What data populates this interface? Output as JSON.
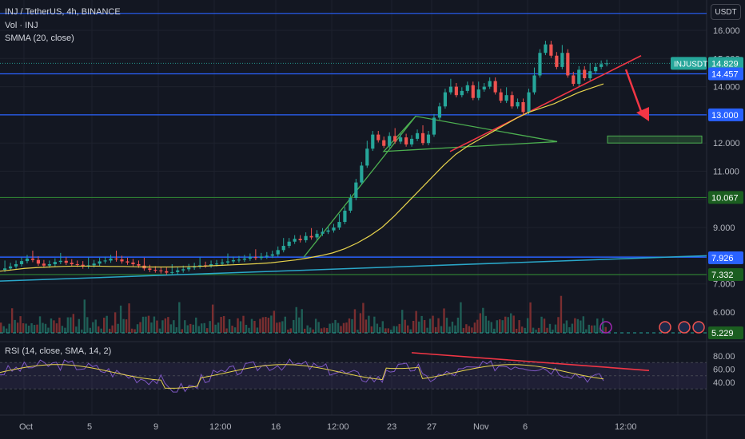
{
  "header": {
    "symbol": "INJ / TetherUS, 4h, BINANCE",
    "volume": "Vol · INJ",
    "smma": "SMMA (20, close)"
  },
  "currency_button": "USDT",
  "price_axis": {
    "ticks": [
      "16.000",
      "15.000",
      "14.000",
      "13.000",
      "12.000",
      "11.000",
      "10.000",
      "9.000",
      "8.000",
      "7.000",
      "6.000"
    ]
  },
  "price_tags": [
    {
      "label": "INJUSDT",
      "value": "14.829",
      "color": "#26a69a"
    },
    {
      "value": "14.457",
      "color": "#2962ff"
    },
    {
      "value": "13.000",
      "color": "#2962ff"
    },
    {
      "value": "10.067",
      "color": "#1b5e20"
    },
    {
      "value": "7.926",
      "color": "#2962ff"
    },
    {
      "value": "7.332",
      "color": "#1b5e20"
    },
    {
      "value": "5.229",
      "color": "#1b5e20"
    }
  ],
  "rsi": {
    "title": "RSI (14, close, SMA, 14, 2)",
    "ticks": [
      "80.00",
      "60.00",
      "40.00"
    ]
  },
  "time_axis": [
    "Oct",
    "5",
    "9",
    "12:00",
    "16",
    "12:00",
    "23",
    "27",
    "Nov",
    "6",
    "12:00"
  ],
  "colors": {
    "up": "#26a69a",
    "down": "#ef5350",
    "blue": "#2962ff",
    "green_line": "#2e7d32",
    "smma": "#e8d44d",
    "rsi": "#7e57c2"
  },
  "chart_data": {
    "type": "candlestick",
    "symbol": "INJ / TetherUS, 4h, BINANCE",
    "close": [
      7.55,
      7.62,
      7.7,
      7.81,
      7.9,
      7.85,
      7.72,
      7.65,
      7.7,
      7.78,
      7.82,
      7.75,
      7.7,
      7.68,
      7.62,
      7.66,
      7.72,
      7.8,
      7.83,
      7.9,
      7.87,
      7.8,
      7.76,
      7.7,
      7.65,
      7.55,
      7.5,
      7.48,
      7.45,
      7.4,
      7.42,
      7.48,
      7.52,
      7.58,
      7.62,
      7.66,
      7.65,
      7.7,
      7.72,
      7.76,
      7.8,
      7.84,
      7.86,
      7.9,
      7.95,
      7.92,
      7.97,
      8.0,
      8.05,
      8.2,
      8.35,
      8.5,
      8.6,
      8.55,
      8.7,
      8.65,
      8.78,
      8.85,
      8.9,
      9.0,
      9.2,
      9.6,
      10.05,
      10.6,
      11.2,
      11.8,
      12.3,
      12.1,
      11.9,
      12.25,
      12.05,
      12.2,
      11.95,
      12.15,
      12.35,
      12.0,
      12.3,
      12.9,
      13.3,
      13.8,
      14.0,
      13.7,
      13.85,
      14.05,
      13.6,
      13.9,
      14.0,
      14.2,
      13.8,
      13.5,
      13.7,
      13.3,
      13.45,
      13.1,
      13.8,
      14.4,
      15.2,
      15.5,
      15.1,
      14.7,
      15.2,
      14.4,
      14.1,
      14.6,
      14.3,
      14.55,
      14.7,
      14.8,
      14.83
    ],
    "smma": [
      7.45,
      7.5,
      7.55,
      7.58,
      7.6,
      7.62,
      7.63,
      7.63,
      7.63,
      7.62,
      7.62,
      7.61,
      7.6,
      7.6,
      7.6,
      7.61,
      7.62,
      7.64,
      7.66,
      7.68,
      7.7,
      7.72,
      7.75,
      7.8,
      7.85,
      7.92,
      8.0,
      8.1,
      8.25,
      8.45,
      8.7,
      9.0,
      9.4,
      9.85,
      10.3,
      10.75,
      11.2,
      11.6,
      11.9,
      12.15,
      12.4,
      12.65,
      12.9,
      13.1,
      13.25,
      13.4,
      13.6,
      13.8,
      13.95,
      14.1
    ],
    "horizontal_levels": [
      14.457,
      13.0,
      10.067,
      7.926,
      7.332,
      16.6
    ],
    "target_zone": [
      12.0,
      12.25
    ],
    "rsi_levels": [
      80,
      60,
      40
    ]
  }
}
